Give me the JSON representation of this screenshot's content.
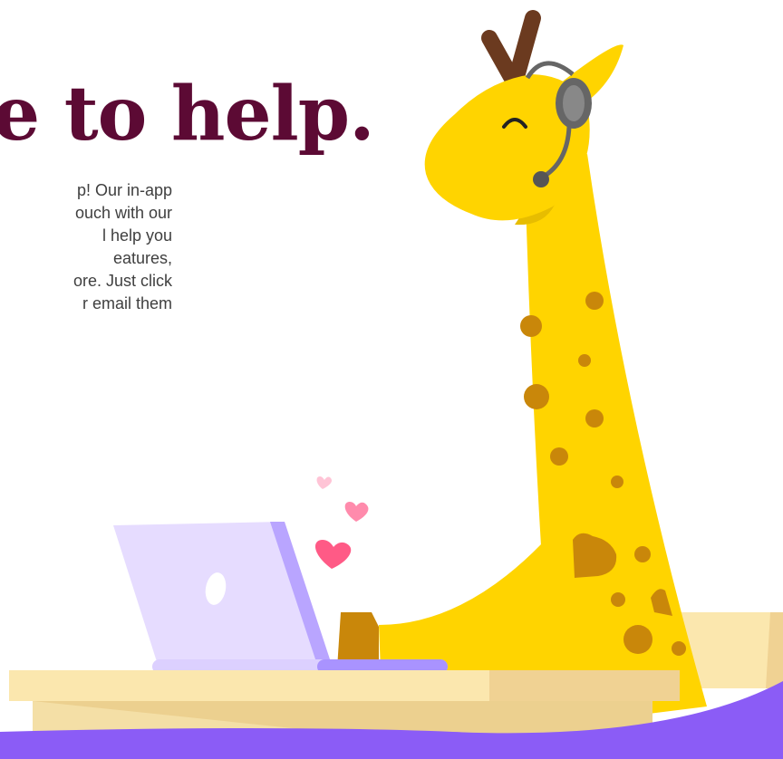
{
  "hero": {
    "title": "e to help.",
    "body_lines": [
      "p! Our in-app",
      "ouch with our",
      "l help you",
      "eatures,",
      "ore. Just click",
      "r email them"
    ]
  },
  "illustration": {
    "subject": "giraffe-with-headset-at-laptop",
    "colors": {
      "title": "#5c0a34",
      "giraffe": "#ffd400",
      "spots": "#c9870a",
      "horns": "#6b3a1f",
      "headset": "#666666",
      "laptop": "#e6dcff",
      "laptop_base": "#a993ff",
      "desk": "#fbe7ae",
      "heart": "#ff5a86",
      "footer_wave": "#8b5cf6"
    }
  }
}
